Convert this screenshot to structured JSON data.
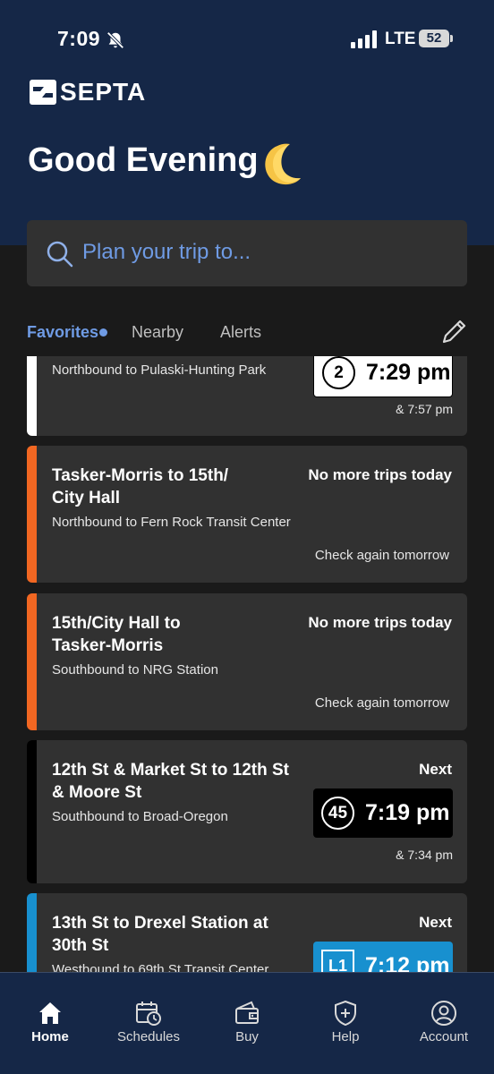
{
  "status_bar": {
    "time": "7:09",
    "network": "LTE",
    "battery": "52"
  },
  "brand": {
    "name": "SEPTA"
  },
  "greeting": "Good Evening",
  "search": {
    "placeholder": "Plan your trip to..."
  },
  "tabs": [
    {
      "label": "Favorites",
      "active": true
    },
    {
      "label": "Nearby",
      "active": false
    },
    {
      "label": "Alerts",
      "active": false
    }
  ],
  "trips": [
    {
      "title": "",
      "subtitle": "Northbound to Pulaski-Hunting Park",
      "route": "2",
      "next_time": "7:29 pm",
      "later": "& 7:57 pm",
      "line_color": "#ffffff"
    },
    {
      "title": "Tasker-Morris to 15th/ City Hall",
      "subtitle": "Northbound to Fern Rock Transit Center",
      "status": "No more trips today",
      "note": "Check again tomorrow",
      "line_color": "#f26722"
    },
    {
      "title": "15th/City Hall to Tasker-Morris",
      "subtitle": "Southbound to NRG Station",
      "status": "No more trips today",
      "note": "Check again tomorrow",
      "line_color": "#f26722"
    },
    {
      "title": "12th St & Market St to 12th St & Moore St",
      "subtitle": "Southbound to Broad-Oregon",
      "status": "Next",
      "route": "45",
      "next_time": "7:19 pm",
      "later": "& 7:34 pm",
      "line_color": "#000000"
    },
    {
      "title": "13th St to Drexel Station at 30th St",
      "subtitle": "Westbound to 69th St Transit Center",
      "status": "Next",
      "route": "L1",
      "next_time": "7:12 pm",
      "line_color": "#1890cf"
    }
  ],
  "bottom_nav": [
    {
      "label": "Home",
      "icon": "home-icon",
      "active": true
    },
    {
      "label": "Schedules",
      "icon": "calendar-clock-icon",
      "active": false
    },
    {
      "label": "Buy",
      "icon": "wallet-icon",
      "active": false
    },
    {
      "label": "Help",
      "icon": "shield-plus-icon",
      "active": false
    },
    {
      "label": "Account",
      "icon": "account-icon",
      "active": false
    }
  ],
  "colors": {
    "header": "#152747",
    "background": "#1a1a1a",
    "card": "#313131",
    "accent": "#6f9be4"
  }
}
